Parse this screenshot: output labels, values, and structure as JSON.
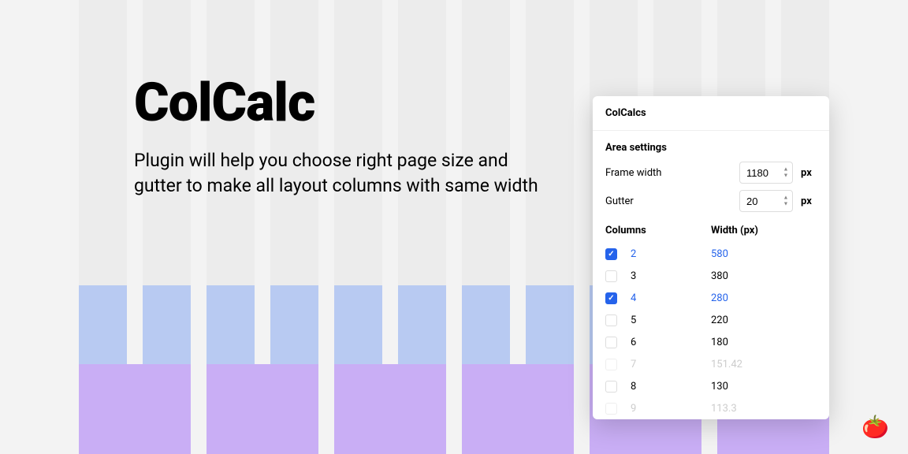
{
  "hero": {
    "title": "ColCalc",
    "description": "Plugin will help you choose right page size and gutter to make all layout columns with same width"
  },
  "panel": {
    "title": "ColCalcs",
    "area_settings_label": "Area settings",
    "frame_width_label": "Frame width",
    "frame_width_value": "1180",
    "gutter_label": "Gutter",
    "gutter_value": "20",
    "unit": "px",
    "columns_header": "Columns",
    "width_header": "Width (px)",
    "rows": [
      {
        "cols": "2",
        "width": "580",
        "checked": true,
        "disabled": false
      },
      {
        "cols": "3",
        "width": "380",
        "checked": false,
        "disabled": false
      },
      {
        "cols": "4",
        "width": "280",
        "checked": true,
        "disabled": false
      },
      {
        "cols": "5",
        "width": "220",
        "checked": false,
        "disabled": false
      },
      {
        "cols": "6",
        "width": "180",
        "checked": false,
        "disabled": false
      },
      {
        "cols": "7",
        "width": "151.42",
        "checked": false,
        "disabled": true
      },
      {
        "cols": "8",
        "width": "130",
        "checked": false,
        "disabled": false
      },
      {
        "cols": "9",
        "width": "113.3",
        "checked": false,
        "disabled": true
      }
    ]
  },
  "tomato": "🍅"
}
